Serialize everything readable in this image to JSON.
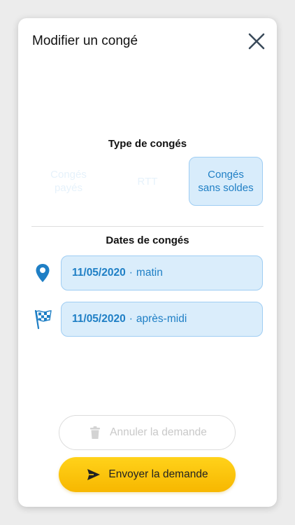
{
  "modal": {
    "title": "Modifier un congé"
  },
  "leave_type": {
    "label": "Type de congés",
    "options": [
      {
        "line1": "Congés",
        "line2": "payés",
        "selected": false
      },
      {
        "line1": "RTT",
        "line2": "",
        "selected": false
      },
      {
        "line1": "Congés",
        "line2": "sans soldes",
        "selected": true
      }
    ]
  },
  "dates": {
    "label": "Dates de congés",
    "start": {
      "date": "11/05/2020",
      "separator": "·",
      "period": "matin"
    },
    "end": {
      "date": "11/05/2020",
      "separator": "·",
      "period": "après-midi"
    }
  },
  "actions": {
    "cancel_label": "Annuler la demande",
    "send_label": "Envoyer la demande"
  },
  "colors": {
    "accent": "#1f7fc5",
    "selected_bg": "#d8ecfb",
    "send_button": "#ffc90c"
  },
  "icons": {
    "close": "close-icon",
    "start": "location-pin-icon",
    "end": "checkered-flag-icon",
    "cancel": "trash-icon",
    "send": "send-icon"
  }
}
